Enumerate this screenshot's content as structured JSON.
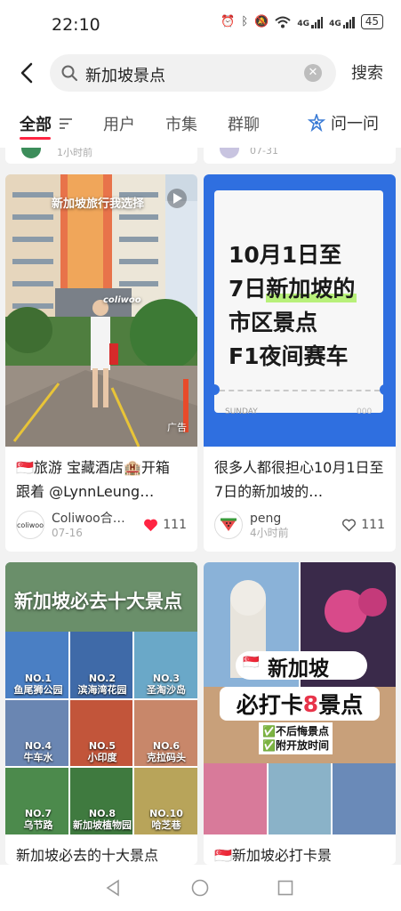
{
  "status": {
    "time": "22:10",
    "net1": "4G",
    "net2": "4G",
    "battery": "45"
  },
  "search": {
    "query": "新加坡景点",
    "button": "搜索"
  },
  "tabs": [
    {
      "label": "全部"
    },
    {
      "label": "用户"
    },
    {
      "label": "市集"
    },
    {
      "label": "群聊"
    }
  ],
  "ask": {
    "label": "问一问"
  },
  "stubs": [
    {
      "meta": "1小时前"
    },
    {
      "meta": "07-31"
    }
  ],
  "cards": [
    {
      "image_caption": "新加坡旅行我选择",
      "image_brand": "coliwoo",
      "image_tag": "广告",
      "title": "🇸🇬旅游 宝藏酒店🏨开箱 跟着 @LynnLeung…",
      "author": "Coliwoo合…",
      "author_avatar": "coliwoo",
      "date": "07-16",
      "likes": "111",
      "liked": true
    },
    {
      "image_lines": [
        "10月1日至",
        "7日新加坡的",
        "市区景点",
        "F1夜间赛车"
      ],
      "image_footer_left": "SUNDAY",
      "image_footer_right": "000",
      "title": "很多人都很担心10月1日至7日的新加坡的…",
      "author": "peng",
      "date": "4小时前",
      "likes": "111",
      "liked": false
    },
    {
      "image_title": "新加坡必去十大景点",
      "grid": [
        {
          "no": "NO.1",
          "name": "鱼尾狮公园"
        },
        {
          "no": "NO.2",
          "name": "滨海湾花园"
        },
        {
          "no": "NO.3",
          "name": "圣淘沙岛"
        },
        {
          "no": "NO.4",
          "name": "牛车水"
        },
        {
          "no": "NO.5",
          "name": "小印度"
        },
        {
          "no": "NO.6",
          "name": "克拉码头"
        },
        {
          "no": "NO.7",
          "name": "乌节路"
        },
        {
          "no": "NO.8",
          "name": "新加坡植物园"
        },
        {
          "no": "NO.10",
          "name": "哈芝巷"
        }
      ],
      "title": "新加坡必去的十大景点"
    },
    {
      "image_title": "新加坡",
      "image_subtitle_pre": "必打卡",
      "image_subtitle_num": "8",
      "image_subtitle_post": "景点",
      "image_checks": [
        "不后悔景点",
        "附开放时间"
      ],
      "title": "🇸🇬新加坡必打卡景"
    }
  ],
  "colors": {
    "accent": "#ff2442",
    "heart": "#ff2442",
    "card_blue": "#2f6fe0",
    "highlight_green": "#b8f07a"
  }
}
